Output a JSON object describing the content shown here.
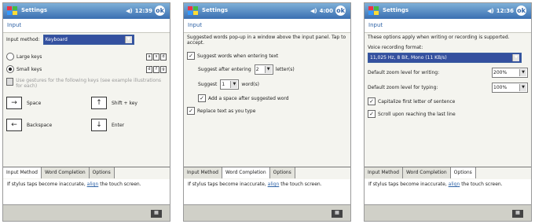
{
  "screens": [
    {
      "title": "Settings",
      "time": "12:39",
      "header": "Input",
      "input_method_label": "Input method:",
      "input_method_value": "Keyboard",
      "large_keys": "Large keys",
      "small_keys": "Small keys",
      "gestures_note": "Use gestures for the following keys (see example illustrations for each)",
      "gestures": [
        "Space",
        "Shift + key",
        "Backspace",
        "Enter"
      ],
      "tabs": [
        "Input Method",
        "Word Completion",
        "Options"
      ],
      "footer_text": "If stylus taps become inaccurate, ",
      "footer_link": "align",
      "footer_suffix": " the touch screen."
    },
    {
      "title": "Settings",
      "time": "4:00",
      "header": "Input",
      "intro": "Suggested words pop-up in a window above the input panel. Tap to accept.",
      "suggest_words": "Suggest words when entering text",
      "suggest_after": "Suggest after entering",
      "letters_value": "2",
      "letters_label": "letter(s)",
      "suggest_label": "Suggest",
      "words_value": "1",
      "words_label": "word(s)",
      "add_space": "Add a space after suggested word",
      "replace_text": "Replace text as you type",
      "tabs": [
        "Input Method",
        "Word Completion",
        "Options"
      ],
      "footer_text": "If stylus taps become inaccurate, ",
      "footer_link": "align",
      "footer_suffix": " the touch screen."
    },
    {
      "title": "Settings",
      "time": "12:36",
      "header": "Input",
      "intro": "These options apply when writing or recording is supported.",
      "voice_label": "Voice recording format:",
      "voice_value": "11,025 Hz, 8 Bit, Mono (11 KB/s)",
      "zoom_writing_label": "Default zoom level for writing:",
      "zoom_writing_value": "200%",
      "zoom_typing_label": "Default zoom level for typing:",
      "zoom_typing_value": "100%",
      "capitalize": "Capitalize first letter of sentence",
      "scroll": "Scroll upon reaching the last line",
      "tabs": [
        "Input Method",
        "Word Completion",
        "Options"
      ],
      "footer_text": "If stylus taps become inaccurate, ",
      "footer_link": "align",
      "footer_suffix": " the touch screen."
    }
  ]
}
